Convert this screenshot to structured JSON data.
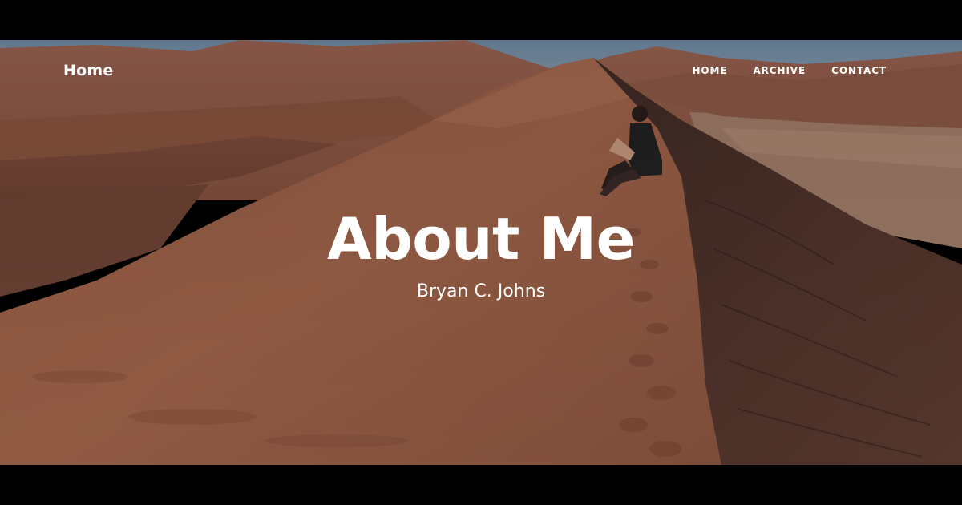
{
  "navbar": {
    "brand": "Home",
    "links": [
      {
        "label": "HOME"
      },
      {
        "label": "ARCHIVE"
      },
      {
        "label": "CONTACT"
      }
    ]
  },
  "header": {
    "title": "About Me",
    "subtitle": "Bryan C. Johns"
  },
  "background": {
    "sky_color": "#6d8aa6",
    "sand_light": "#a8654a",
    "sand_mid": "#8e5540",
    "sand_shadow": "#4a2f28",
    "letterbox_color": "#000000"
  }
}
